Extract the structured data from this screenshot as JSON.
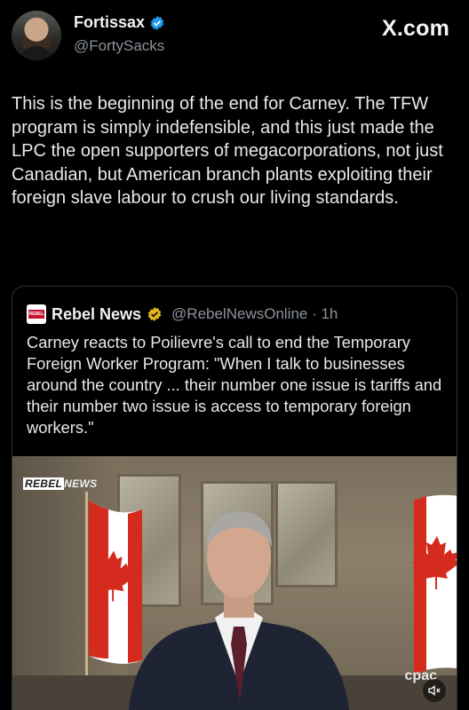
{
  "tweet": {
    "display_name": "Fortissax",
    "handle": "@FortySacks",
    "verified_color": "#1d9bf0",
    "text": "This is the beginning of the end for Carney. The TFW program is simply indefensible, and this just made the LPC the open supporters of megacorporations, not just Canadian, but American branch plants exploiting their foreign slave labour to crush our living standards."
  },
  "watermark": "X.com",
  "quoted_tweet": {
    "display_name": "Rebel News",
    "handle_time": "@RebelNewsOnline · 1h",
    "verified_color": "#e2b719",
    "logo_icon": "rebel-news-logo",
    "text": "Carney reacts to Poilievre's call to end the Temporary Foreign Worker Program: \"When I talk to businesses around the country ... their number one issue is tariffs and their number two issue is access to temporary foreign workers.\""
  },
  "video": {
    "overlay_left": "REBEL",
    "overlay_right": "NEWS",
    "broadcaster": "cpac",
    "mute_icon": "speaker-muted-icon"
  }
}
